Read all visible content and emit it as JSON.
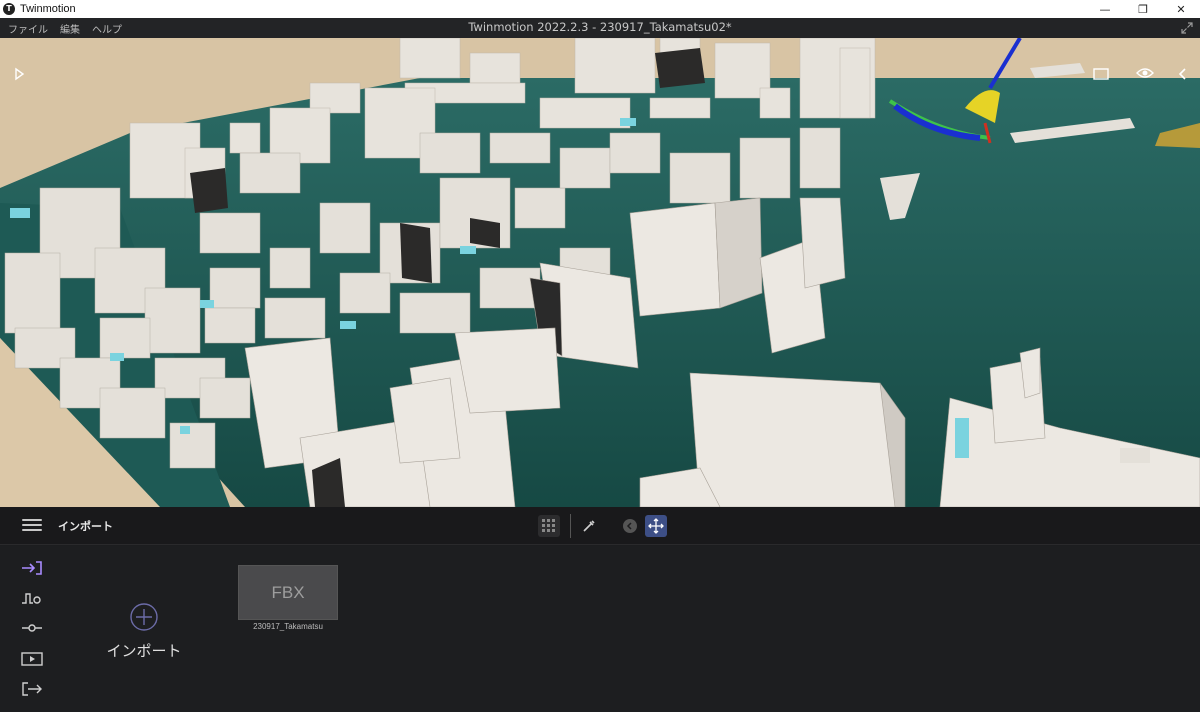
{
  "window": {
    "app_name": "Twinmotion",
    "logo_letter": "T",
    "minimize_glyph": "—",
    "maximize_glyph": "❐",
    "close_glyph": "✕"
  },
  "menubar": {
    "items": [
      "ファイル",
      "編集",
      "ヘルプ"
    ],
    "document_title": "Twinmotion 2022.2.3 - 230917_Takamatsu02*"
  },
  "viewport": {
    "icons": [
      "play-panel-icon",
      "aspect-frame-icon",
      "eye-icon",
      "collapse-panel-icon"
    ],
    "colors": {
      "ground": "#d8c4a4",
      "water": "#1f5a55",
      "building": "#e6e1da",
      "gizmo_yellow": "#e6d326",
      "gizmo_blue": "#1a2fd0",
      "gizmo_green": "#3ec24a",
      "gizmo_red": "#d03020"
    }
  },
  "toolbar": {
    "section_title": "インポート",
    "buttons": [
      "grid-view-icon",
      "eyedropper-icon",
      "back-icon",
      "move-icon"
    ],
    "active_color": "#3d4f86"
  },
  "panel": {
    "side_icons": [
      "import-icon",
      "context-icon",
      "settings-icon",
      "media-icon",
      "export-icon"
    ],
    "import_label": "インポート",
    "files": [
      {
        "type": "FBX",
        "name": "230917_Takamatsu"
      }
    ]
  }
}
